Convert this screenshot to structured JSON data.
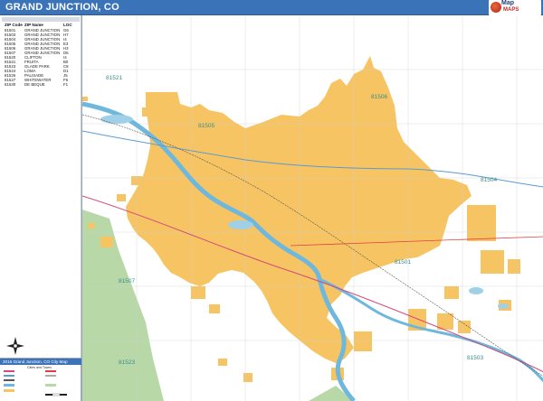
{
  "header": {
    "title": "GRAND JUNCTION, CO",
    "logo_line1": "Map",
    "logo_line2": "MAPS"
  },
  "zip_panel": {
    "columns": [
      "ZIP Code",
      "ZIP Name",
      "LOC"
    ],
    "rows": [
      {
        "zip": "81501",
        "name": "GRAND JUNCTION",
        "loc": "G6"
      },
      {
        "zip": "81503",
        "name": "GRAND JUNCTION",
        "loc": "H7"
      },
      {
        "zip": "81504",
        "name": "GRAND JUNCTION",
        "loc": "I4"
      },
      {
        "zip": "81505",
        "name": "GRAND JUNCTION",
        "loc": "E3"
      },
      {
        "zip": "81506",
        "name": "GRAND JUNCTION",
        "loc": "H3"
      },
      {
        "zip": "81507",
        "name": "GRAND JUNCTION",
        "loc": "D5"
      },
      {
        "zip": "81520",
        "name": "CLIFTON",
        "loc": "I4"
      },
      {
        "zip": "81521",
        "name": "FRUITA",
        "loc": "B0"
      },
      {
        "zip": "81523",
        "name": "GLADE PARK",
        "loc": "C8"
      },
      {
        "zip": "81524",
        "name": "LOMA",
        "loc": "D1"
      },
      {
        "zip": "81526",
        "name": "PALISADE",
        "loc": "J5"
      },
      {
        "zip": "81527",
        "name": "WHITEWATER",
        "loc": "F6"
      },
      {
        "zip": "81630",
        "name": "DE BEQUE",
        "loc": "F1"
      }
    ]
  },
  "map_labels": [
    {
      "id": "81521",
      "text": "81521"
    },
    {
      "id": "81505",
      "text": "81505"
    },
    {
      "id": "81506",
      "text": "81506"
    },
    {
      "id": "81504",
      "text": "81504"
    },
    {
      "id": "81501",
      "text": "81501"
    },
    {
      "id": "81507",
      "text": "81507"
    },
    {
      "id": "81523",
      "text": "81523"
    },
    {
      "id": "81503",
      "text": "81503"
    }
  ],
  "legend": {
    "title": "2016 Grand Junction, CO City Map",
    "subtitle": "Cities and Towns"
  },
  "colors": {
    "title_bar": "#3b73b9",
    "city_fill": "#f7c463",
    "water": "#9fd0e8",
    "river": "#6fb8dd",
    "national_forest": "#b8d8a8",
    "zip_label": "#3a8b8c"
  }
}
